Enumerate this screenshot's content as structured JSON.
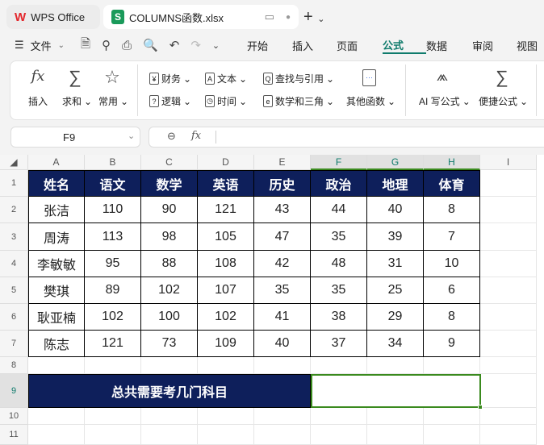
{
  "tabs": {
    "home": "WPS Office",
    "file": "COLUMNS函数.xlsx"
  },
  "menu": {
    "file": "文件",
    "items": [
      "开始",
      "插入",
      "页面",
      "公式",
      "数据",
      "审阅",
      "视图"
    ],
    "active": "公式"
  },
  "ribbon": {
    "insert": "插入",
    "sum": "求和",
    "common": "常用",
    "finance": "财务",
    "text": "文本",
    "lookup": "查找与引用",
    "logic": "逻辑",
    "time": "时间",
    "math": "数学和三角",
    "other": "其他函数",
    "ai": "AI 写公式",
    "quick": "便捷公式"
  },
  "formula_bar": {
    "cell_ref": "F9",
    "fx": "fx",
    "value": ""
  },
  "columns": [
    "A",
    "B",
    "C",
    "D",
    "E",
    "F",
    "G",
    "H",
    "I"
  ],
  "rows": [
    "1",
    "2",
    "3",
    "4",
    "5",
    "6",
    "7",
    "8",
    "9",
    "10",
    "11"
  ],
  "table": {
    "headers": [
      "姓名",
      "语文",
      "数学",
      "英语",
      "历史",
      "政治",
      "地理",
      "体育"
    ],
    "data": [
      [
        "张洁",
        "110",
        "90",
        "121",
        "43",
        "44",
        "40",
        "8"
      ],
      [
        "周涛",
        "113",
        "98",
        "105",
        "47",
        "35",
        "39",
        "7"
      ],
      [
        "李敏敏",
        "95",
        "88",
        "108",
        "42",
        "48",
        "31",
        "10"
      ],
      [
        "樊琪",
        "89",
        "102",
        "107",
        "35",
        "35",
        "25",
        "6"
      ],
      [
        "耿亚楠",
        "102",
        "100",
        "102",
        "41",
        "38",
        "29",
        "8"
      ],
      [
        "陈志",
        "121",
        "73",
        "109",
        "40",
        "37",
        "34",
        "9"
      ]
    ]
  },
  "summary_label": "总共需要考几门科目",
  "summary_value": "",
  "colors": {
    "header": "#0e1f5b",
    "selection": "#3a8a1e",
    "accent": "#0f7b6c"
  }
}
